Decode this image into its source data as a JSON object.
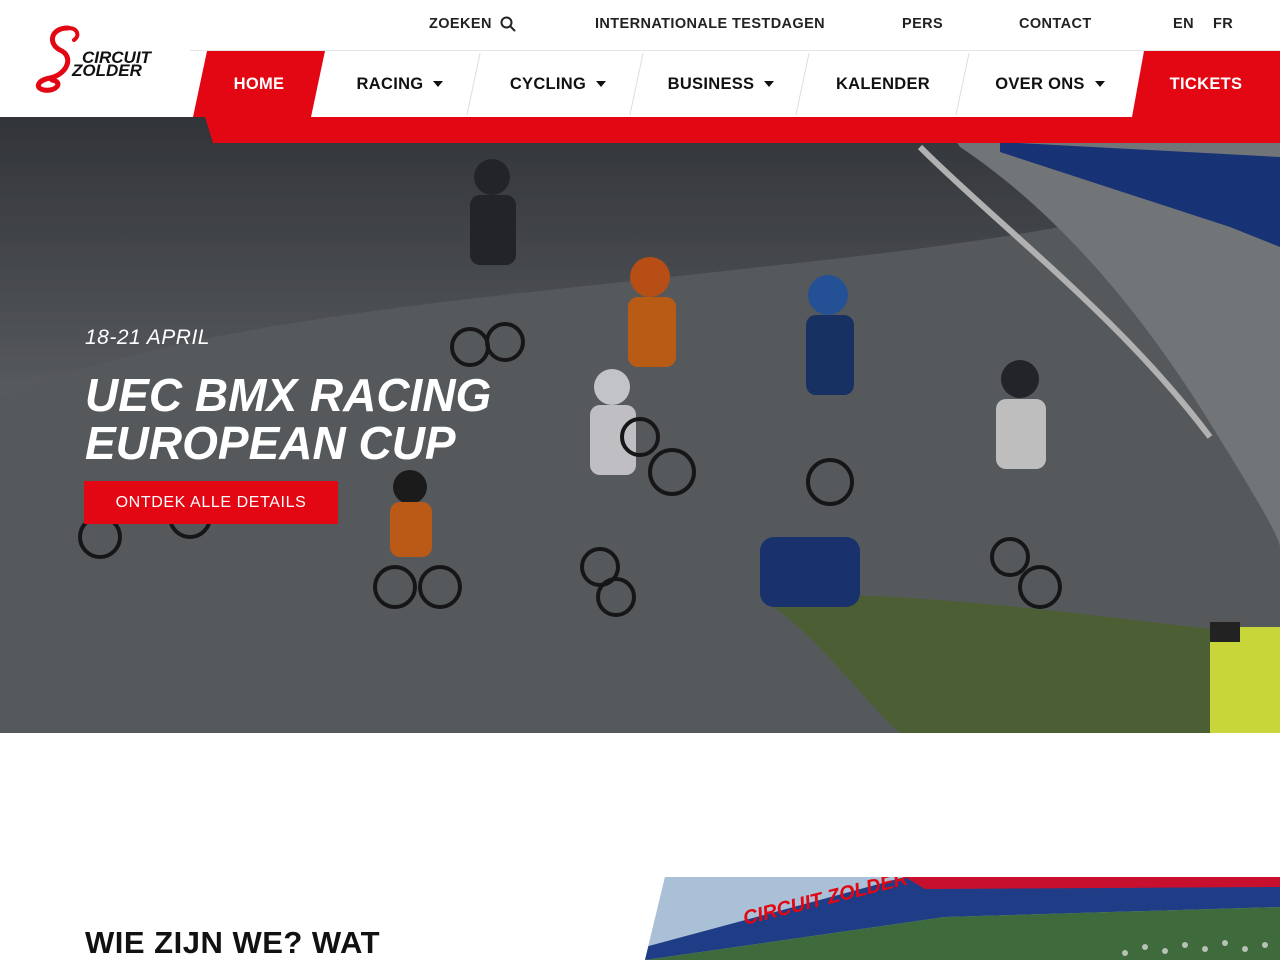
{
  "header": {
    "logo_text": [
      "CIRCUIT",
      "ZOLDER"
    ],
    "top_links": {
      "search": "ZOEKEN",
      "testdays": "INTERNATIONALE TESTDAGEN",
      "press": "PERS",
      "contact": "CONTACT"
    },
    "languages": [
      "EN",
      "FR"
    ],
    "nav": {
      "home": "HOME",
      "racing": "RACING",
      "cycling": "CYCLING",
      "business": "BUSINESS",
      "calendar": "KALENDER",
      "about": "OVER ONS",
      "tickets": "TICKETS"
    }
  },
  "hero": {
    "date": "18-21 APRIL",
    "title_line1": "UEC BMX RACING",
    "title_line2": "EUROPEAN CUP",
    "button": "ONTDEK ALLE DETAILS"
  },
  "about": {
    "title": "WIE ZIJN WE? WAT",
    "image_sign": "CIRCUIT ZOLDER"
  },
  "colors": {
    "brand_red": "#e30613",
    "text_dark": "#111111",
    "white": "#ffffff"
  },
  "icons": {
    "search": "search-icon",
    "dropdown": "chevron-down-icon"
  }
}
